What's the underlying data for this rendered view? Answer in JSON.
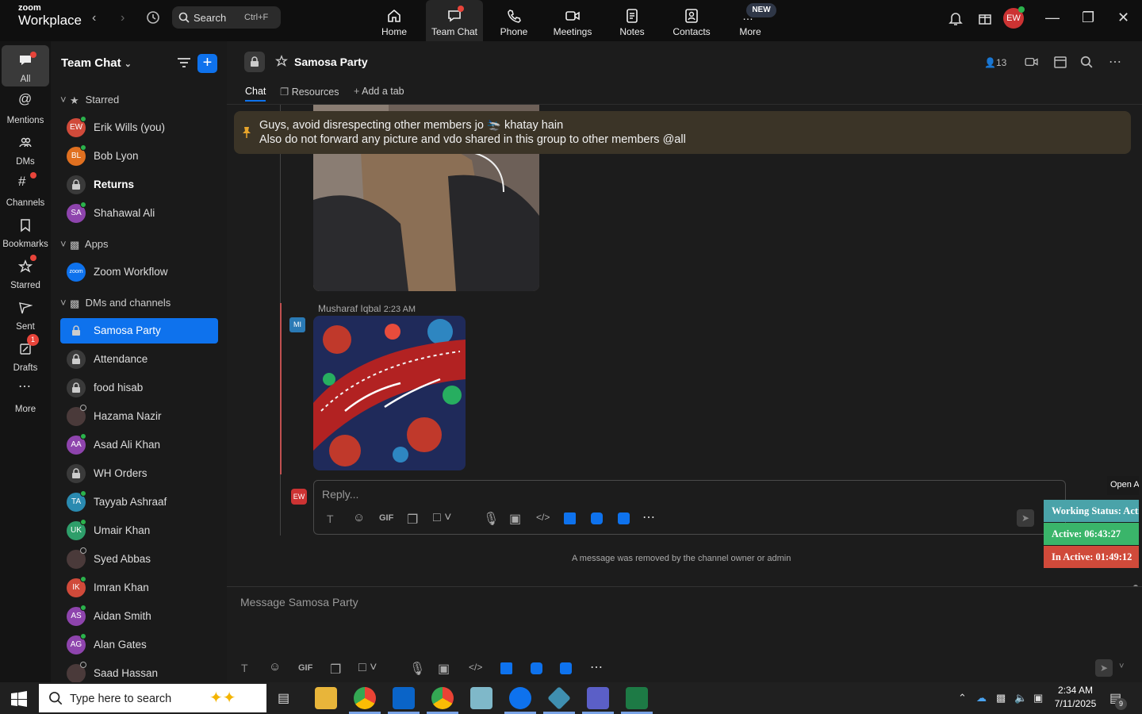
{
  "app": {
    "brand_top": "zoom",
    "brand_bottom": "Workplace"
  },
  "search": {
    "label": "Search",
    "shortcut": "Ctrl+F"
  },
  "topnav": [
    {
      "label": "Home",
      "icon": "home-icon"
    },
    {
      "label": "Team Chat",
      "icon": "chat-icon",
      "active": true
    },
    {
      "label": "Phone",
      "icon": "phone-icon"
    },
    {
      "label": "Meetings",
      "icon": "video-icon"
    },
    {
      "label": "Notes",
      "icon": "notes-icon"
    },
    {
      "label": "Contacts",
      "icon": "contacts-icon"
    },
    {
      "label": "More",
      "icon": "more-icon",
      "badge": "NEW"
    }
  ],
  "user": {
    "initials": "EW"
  },
  "rail": [
    {
      "label": "All",
      "active": true
    },
    {
      "label": "Mentions"
    },
    {
      "label": "DMs"
    },
    {
      "label": "Channels"
    },
    {
      "label": "Bookmarks"
    },
    {
      "label": "Starred"
    },
    {
      "label": "Sent"
    },
    {
      "label": "Drafts",
      "badge": "1"
    },
    {
      "label": "More"
    }
  ],
  "sidebar": {
    "title": "Team Chat",
    "sections": {
      "starred": "Starred",
      "apps": "Apps",
      "dms": "DMs and channels"
    },
    "starred": [
      {
        "name": "Erik Wills (you)",
        "initials": "EW",
        "color": "#d04a3a"
      },
      {
        "name": "Bob Lyon",
        "initials": "BL",
        "color": "#e07020"
      },
      {
        "name": "Returns",
        "type": "channel"
      },
      {
        "name": "Shahawal Ali",
        "initials": "SA",
        "color": "#8e44ad"
      }
    ],
    "apps": [
      {
        "name": "Zoom Workflow",
        "initials": "zoom"
      }
    ],
    "dms": [
      {
        "name": "Samosa Party",
        "type": "channel",
        "selected": true
      },
      {
        "name": "Attendance",
        "type": "channel"
      },
      {
        "name": "food hisab",
        "type": "channel"
      },
      {
        "name": "Hazama Nazir",
        "type": "photo"
      },
      {
        "name": "Asad Ali Khan",
        "initials": "AA",
        "color": "#8e44ad"
      },
      {
        "name": "WH Orders",
        "type": "channel"
      },
      {
        "name": "Tayyab Ashraaf",
        "initials": "TA",
        "color": "#2a8ab0"
      },
      {
        "name": "Umair Khan",
        "initials": "UK",
        "color": "#2e9e6a"
      },
      {
        "name": "Syed Abbas",
        "type": "photo"
      },
      {
        "name": "Imran Khan",
        "initials": "IK",
        "color": "#d04a3a"
      },
      {
        "name": "Aidan Smith",
        "initials": "AS",
        "color": "#8e44ad"
      },
      {
        "name": "Alan Gates",
        "initials": "AG",
        "color": "#8e44ad"
      },
      {
        "name": "Saad Hassan",
        "type": "photo"
      }
    ]
  },
  "channel": {
    "title": "Samosa Party",
    "members": "13",
    "tabs": [
      "Chat",
      "Resources",
      "Add a tab"
    ]
  },
  "pinned": {
    "line1": "Guys, avoid disrespecting other members jo 🛬 khatay hain",
    "line2": "Also do not forward any picture and vdo shared in this group to other members @all"
  },
  "message": {
    "sender": "Musharaf Iqbal",
    "time": "2:23 AM",
    "initials": "MI"
  },
  "reply": {
    "placeholder": "Reply..."
  },
  "toolbar": {
    "gif": "GIF"
  },
  "removed_notice": "A message was removed by the channel owner or admin",
  "composer": {
    "placeholder": "Message Samosa Party"
  },
  "extension": {
    "open_label": "Open A",
    "working": "Working Status: Acti",
    "active": "Active: 06:43:27",
    "inactive": "In Active: 01:49:12",
    "colors": {
      "working": "#4aa3a9",
      "active": "#3ab56a",
      "inactive": "#d04a3a"
    }
  },
  "taskbar": {
    "search_placeholder": "Type here to search",
    "time": "2:34 AM",
    "date": "7/11/2025",
    "notifications": "9"
  }
}
